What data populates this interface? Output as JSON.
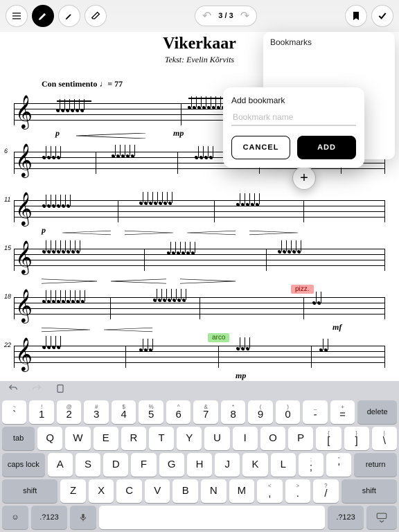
{
  "toolbar": {
    "page_indicator": "3 / 3"
  },
  "sheet": {
    "title": "Vikerkaar",
    "subtitle": "Tekst: Evelin Kõrvits",
    "tempo": "Con sentimento ♩= 77",
    "dynamics": {
      "p": "p",
      "mp": "mp",
      "mf": "mf"
    },
    "measures": {
      "m6": "6",
      "m11": "11",
      "m15": "15",
      "m18": "18",
      "m22": "22"
    },
    "tags": {
      "pizz": "pizz.",
      "arco": "arco"
    }
  },
  "bookmarks": {
    "panel_title": "Bookmarks",
    "dialog_title": "Add bookmark",
    "placeholder": "Bookmark name",
    "value": "",
    "cancel": "CANCEL",
    "add": "ADD",
    "plus": "+"
  },
  "keyboard": {
    "delete": "delete",
    "tab": "tab",
    "caps": "caps lock",
    "return": "return",
    "shift": "shift",
    "nums": ".?123",
    "row_num": [
      {
        "u": "~",
        "m": "`"
      },
      {
        "u": "!",
        "m": "1"
      },
      {
        "u": "@",
        "m": "2"
      },
      {
        "u": "#",
        "m": "3"
      },
      {
        "u": "$",
        "m": "4"
      },
      {
        "u": "%",
        "m": "5"
      },
      {
        "u": "^",
        "m": "6"
      },
      {
        "u": "&",
        "m": "7"
      },
      {
        "u": "*",
        "m": "8"
      },
      {
        "u": "(",
        "m": "9"
      },
      {
        "u": ")",
        "m": "0"
      },
      {
        "u": "_",
        "m": "-"
      },
      {
        "u": "+",
        "m": "="
      }
    ],
    "row_q": [
      {
        "m": "Q"
      },
      {
        "m": "W"
      },
      {
        "m": "E"
      },
      {
        "m": "R"
      },
      {
        "m": "T"
      },
      {
        "m": "Y"
      },
      {
        "m": "U"
      },
      {
        "m": "I"
      },
      {
        "m": "O"
      },
      {
        "m": "P"
      },
      {
        "u": "{",
        "m": "["
      },
      {
        "u": "}",
        "m": "]"
      },
      {
        "u": "|",
        "m": "\\"
      }
    ],
    "row_a": [
      {
        "m": "A"
      },
      {
        "m": "S"
      },
      {
        "m": "D"
      },
      {
        "m": "F"
      },
      {
        "m": "G"
      },
      {
        "m": "H"
      },
      {
        "m": "J"
      },
      {
        "m": "K"
      },
      {
        "m": "L"
      },
      {
        "u": ":",
        "m": ";"
      },
      {
        "u": "\"",
        "m": "'"
      }
    ],
    "row_z": [
      {
        "m": "Z"
      },
      {
        "m": "X"
      },
      {
        "m": "C"
      },
      {
        "m": "V"
      },
      {
        "m": "B"
      },
      {
        "m": "N"
      },
      {
        "m": "M"
      },
      {
        "u": "<",
        "m": ","
      },
      {
        "u": ">",
        "m": "."
      },
      {
        "u": "?",
        "m": "/"
      }
    ]
  }
}
